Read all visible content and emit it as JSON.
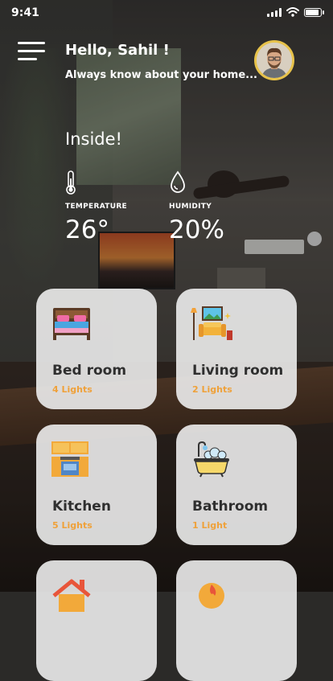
{
  "status_bar": {
    "time": "9:41"
  },
  "header": {
    "greeting": "Hello, Sahil !",
    "subtitle": "Always know about your home..."
  },
  "climate": {
    "section_label": "Inside!",
    "temperature": {
      "label": "TEMPERATURE",
      "value": "26°"
    },
    "humidity": {
      "label": "HUMIDITY",
      "value": "20%"
    }
  },
  "rooms": [
    {
      "name": "Bed room",
      "lights": "4 Lights",
      "icon": "bed-icon"
    },
    {
      "name": "Living room",
      "lights": "2 Lights",
      "icon": "living-room-icon"
    },
    {
      "name": "Kitchen",
      "lights": "5 Lights",
      "icon": "kitchen-icon"
    },
    {
      "name": "Bathroom",
      "lights": "1 Light",
      "icon": "bathtub-icon"
    },
    {
      "name": "",
      "lights": "",
      "icon": "house-icon"
    },
    {
      "name": "",
      "lights": "",
      "icon": "flame-icon"
    }
  ],
  "colors": {
    "accent": "#efa13a",
    "avatar_ring": "#e7c24a",
    "card_bg": "#ececec"
  }
}
